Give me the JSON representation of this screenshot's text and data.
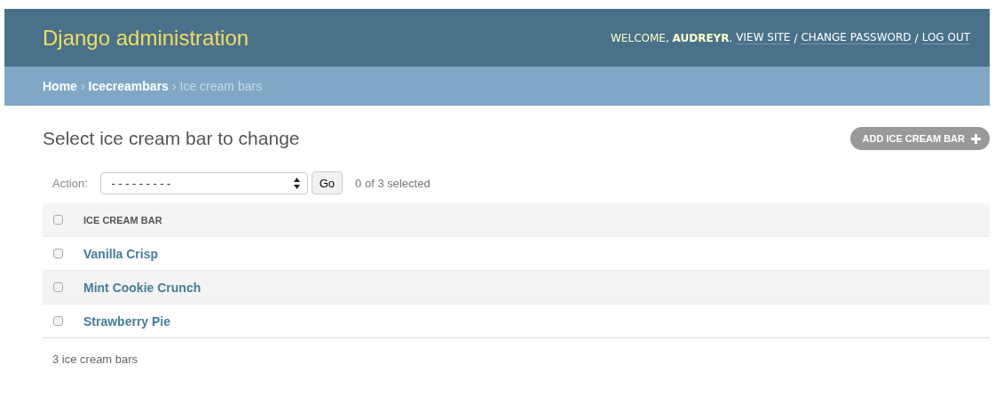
{
  "header": {
    "title": "Django administration",
    "welcome": "WELCOME, **AUDREYR**.",
    "links": [
      "VIEW SITE",
      "CHANGE PASSWORD",
      "LOG OUT"
    ],
    "separator": "/"
  },
  "breadcrumbs": [
    {
      "label": "Home",
      "current": false
    },
    {
      "label": "Icecreambars",
      "current": false
    },
    {
      "label": "Ice cream bars",
      "current": true
    }
  ],
  "breadcrumb_separator": "›",
  "page_title": "Select ice cream bar to change",
  "add_button": "ADD ICE CREAM BAR",
  "actions": {
    "label": "Action:",
    "value": "---------",
    "go": "Go",
    "selected_count": "0 of 3 selected"
  },
  "table": {
    "select_all_checked": false,
    "columns": [
      "ICE CREAM BAR"
    ],
    "rows": [
      {
        "name": "Vanilla Crisp",
        "checked": false
      },
      {
        "name": "Mint Cookie Crunch",
        "checked": false
      },
      {
        "name": "Strawberry Pie",
        "checked": false
      }
    ]
  },
  "footer": "3 ice cream bars"
}
